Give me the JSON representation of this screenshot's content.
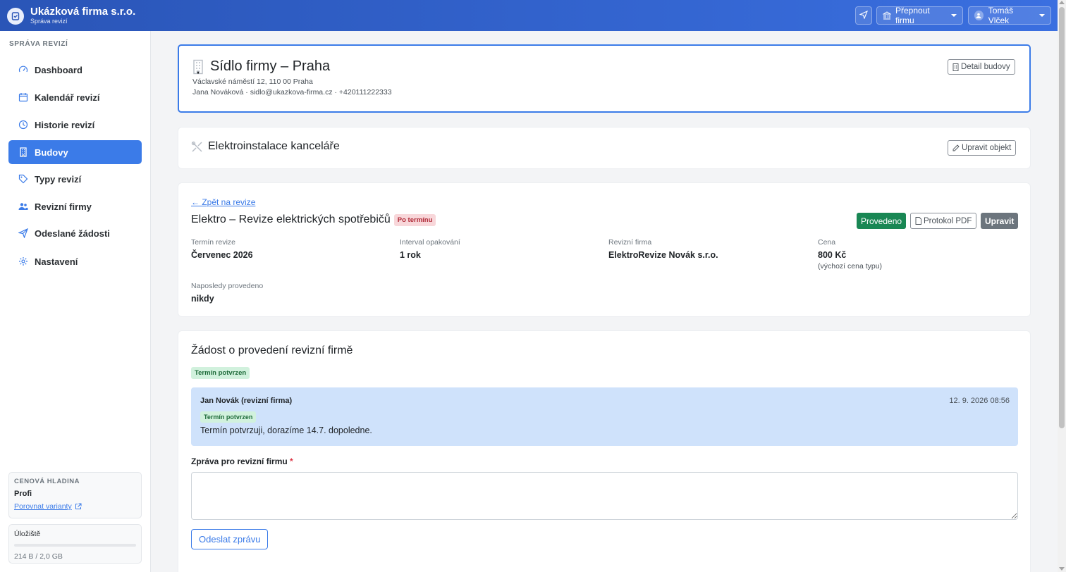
{
  "header": {
    "company": "Ukázková firma s.r.o.",
    "subtitle": "Správa revizí",
    "switch_company": "Přepnout firmu",
    "user": "Tomáš Vlček"
  },
  "sidebar": {
    "heading": "SPRÁVA REVIZÍ",
    "items": [
      {
        "label": "Dashboard",
        "icon": "speedometer-icon"
      },
      {
        "label": "Kalendář revizí",
        "icon": "calendar-icon"
      },
      {
        "label": "Historie revizí",
        "icon": "clock-icon"
      },
      {
        "label": "Budovy",
        "icon": "building-icon",
        "active": true
      },
      {
        "label": "Typy revizí",
        "icon": "tag-icon"
      },
      {
        "label": "Revizní firmy",
        "icon": "people-icon"
      },
      {
        "label": "Odeslané žádosti",
        "icon": "send-icon"
      },
      {
        "label": "Nastavení",
        "icon": "gear-icon"
      }
    ],
    "plan": {
      "label": "CENOVÁ HLADINA",
      "value": "Profi",
      "compare_link": "Porovnat varianty"
    },
    "storage": {
      "label": "Úložiště",
      "used_fraction": 0.0,
      "text": "214 B / 2,0 GB"
    }
  },
  "building": {
    "name": "Sídlo firmy – Praha",
    "address": "Václavské náměstí 12, 110 00 Praha",
    "contact": "Jana Nováková · sidlo@ukazkova-firma.cz · +420111222333",
    "detail_button": "Detail budovy"
  },
  "object": {
    "name": "Elektroinstalace kanceláře",
    "edit_button": "Upravit objekt"
  },
  "revision": {
    "back_link": "← Zpět na revize",
    "title": "Elektro – Revize elektrických spotřebičů",
    "status_badge": "Po termínu",
    "done_button": "Provedeno",
    "pdf_button": "Protokol PDF",
    "edit_button": "Upravit",
    "fields": {
      "term_label": "Termín revize",
      "term_value": "Červenec 2026",
      "interval_label": "Interval opakování",
      "interval_value": "1 rok",
      "firm_label": "Revizní firma",
      "firm_value": "ElektroRevize Novák s.r.o.",
      "price_label": "Cena",
      "price_value": "800 Kč",
      "price_note": "(výchozí cena typu)",
      "last_label": "Naposledy provedeno",
      "last_value": "nikdy"
    }
  },
  "request": {
    "title": "Žádost o provedení revizní firmě",
    "status_badge": "Termín potvrzen",
    "message": {
      "author": "Jan Novák (revizní firma)",
      "timestamp": "12. 9. 2026 08:56",
      "badge": "Termín potvrzen",
      "text": "Termín potvrzuji, dorazíme 14.7. dopoledne."
    },
    "form_label": "Zpráva pro revizní firmu",
    "required_mark": "*",
    "textarea_value": "",
    "send_button": "Odeslat zprávu"
  },
  "colors": {
    "primary": "#3b7be8",
    "header_gradient_start": "#2a55b7",
    "success": "#198754",
    "secondary": "#6c757d",
    "danger_badge_bg": "#f8d7da",
    "success_badge_bg": "#d1f1dd",
    "message_bg": "#cfe2fb"
  }
}
